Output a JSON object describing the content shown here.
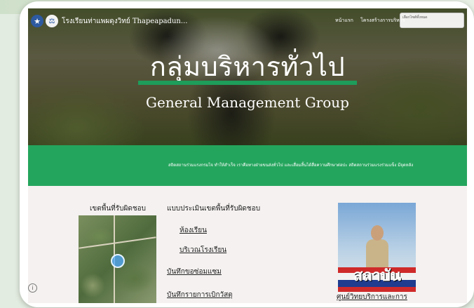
{
  "nav": {
    "site_name": "โรงเรียนท่าแพผดุงวิทย์ Thapeapadun...",
    "links": [
      "หน้าแรก",
      "โครงสร้างการบริหาร"
    ],
    "search_snippet": "เลือกไซต์ทั้งหมด"
  },
  "hero": {
    "title": "กลุ่มบริหารทั่วไป",
    "subtitle": "General Management Group"
  },
  "band": {
    "text": "สถิตสถานร่วมแรงกรมไจ ทำให้สำเร็จ เราคือทางฝ่ายขนส่งทั่วไป และเสื่อมสิ้นได้สื่อความศึกษาต่อปะ สถิตสถานร่วมแรงร่วมแข็ง มีจุดหลัง"
  },
  "content": {
    "left_heading": "เขตพื้นที่รับผิดชอบ",
    "mid_heading": "แบบประเมินเขตพื้นที่รับผิดชอบ",
    "links": [
      "ห้องเรียน",
      "บริเวณโรงเรียน",
      "บันทึกขอซ่อมแซม",
      "บันทึกรายการเบิกวัสดุ"
    ],
    "poster_text": "สถาบัน",
    "center_title": "ศูนย์วิทยบริการและการ"
  },
  "icons": {
    "logo1": "school-emblem-icon",
    "logo2": "crest-icon",
    "info": "info-icon"
  }
}
